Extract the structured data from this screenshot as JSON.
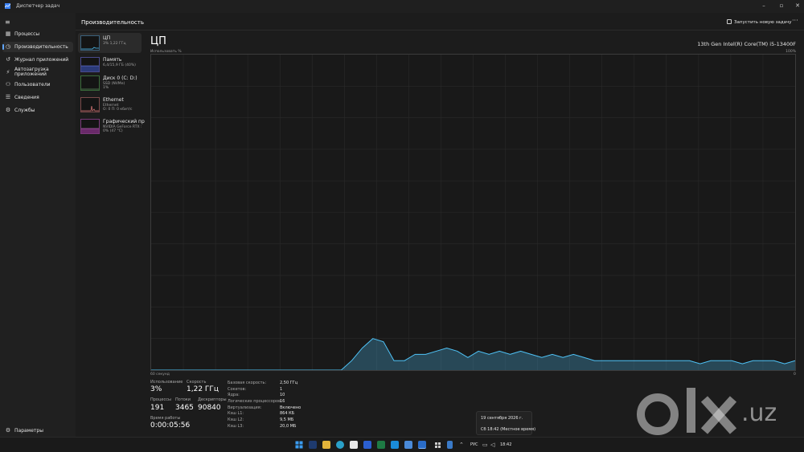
{
  "window": {
    "title": "Диспетчер задач"
  },
  "sidebar": {
    "items": [
      {
        "id": "processes",
        "label": "Процессы",
        "icon": "grid-icon"
      },
      {
        "id": "performance",
        "label": "Производительность",
        "icon": "performance-icon",
        "active": true
      },
      {
        "id": "app-history",
        "label": "Журнал приложений",
        "icon": "history-icon"
      },
      {
        "id": "startup",
        "label": "Автозагрузка приложений",
        "icon": "startup-icon"
      },
      {
        "id": "users",
        "label": "Пользователи",
        "icon": "users-icon"
      },
      {
        "id": "details",
        "label": "Сведения",
        "icon": "list-icon"
      },
      {
        "id": "services",
        "label": "Службы",
        "icon": "services-icon"
      }
    ],
    "settings_label": "Параметры"
  },
  "header": {
    "title": "Производительность",
    "run_task_label": "Запустить новую задачу",
    "more_label": "···"
  },
  "devices": [
    {
      "name": "ЦП",
      "sub1": "3% 1,22 ГГц",
      "sub2": "",
      "active": true
    },
    {
      "name": "Память",
      "sub1": "6,4/15,9 ГБ (40%)",
      "sub2": ""
    },
    {
      "name": "Диск 0 (C: D:)",
      "sub1": "SSD (NVMe)",
      "sub2": "1%"
    },
    {
      "name": "Ethernet",
      "sub1": "Ethernet",
      "sub2": "О: 0 П: 0 кбит/с"
    },
    {
      "name": "Графический пр",
      "sub1": "NVIDIA GeForce RTX :",
      "sub2": "0% (47 °C)"
    }
  ],
  "main": {
    "title": "ЦП",
    "cpu_model": "13th Gen Intel(R) Core(TM) i5-13400F",
    "graph_label_left": "Использовать %",
    "graph_label_right": "100%",
    "graph_bottom_left": "60 секунд",
    "graph_bottom_right": "0",
    "graph_color": "#4fc3f7",
    "usage_history_percent": [
      0,
      0,
      0,
      0,
      0,
      0,
      0,
      0,
      0,
      0,
      0,
      0,
      0,
      0,
      0,
      0,
      0,
      0,
      0,
      3,
      7,
      10,
      9,
      3,
      3,
      5,
      5,
      6,
      7,
      6,
      4,
      6,
      5,
      6,
      5,
      6,
      5,
      4,
      5,
      4,
      5,
      4,
      3,
      3,
      3,
      3,
      3,
      3,
      3,
      3,
      3,
      3,
      2,
      3,
      3,
      3,
      2,
      3,
      3,
      3,
      2,
      3
    ],
    "stats": {
      "usage_label": "Использование",
      "usage_value": "3%",
      "speed_label": "Скорость",
      "speed_value": "1,22 ГГц",
      "processes_label": "Процессы",
      "processes_value": "191",
      "threads_label": "Потоки",
      "threads_value": "3465",
      "handles_label": "Дескрипторы",
      "handles_value": "90840",
      "uptime_label": "Время работы",
      "uptime_value": "0:00:05:56"
    },
    "specs": [
      {
        "label": "Базовая скорость:",
        "value": "2,50 ГГц"
      },
      {
        "label": "Сокетов:",
        "value": "1"
      },
      {
        "label": "Ядра:",
        "value": "10"
      },
      {
        "label": "Логических процессоров:",
        "value": "16"
      },
      {
        "label": "Виртуализация:",
        "value": "Включено"
      },
      {
        "label": "Кэш L1:",
        "value": "864 КБ"
      },
      {
        "label": "Кэш L2:",
        "value": "9,5 МБ"
      },
      {
        "label": "Кэш L3:",
        "value": "20,0 МБ"
      }
    ]
  },
  "popup": {
    "date_line": "19 сентября 2026 г.",
    "time_line": "Сб 18:42 (Местное время)"
  },
  "taskbar": {
    "lang": "РУС",
    "time": "18:42"
  },
  "watermark": {
    "text": ".uz"
  }
}
